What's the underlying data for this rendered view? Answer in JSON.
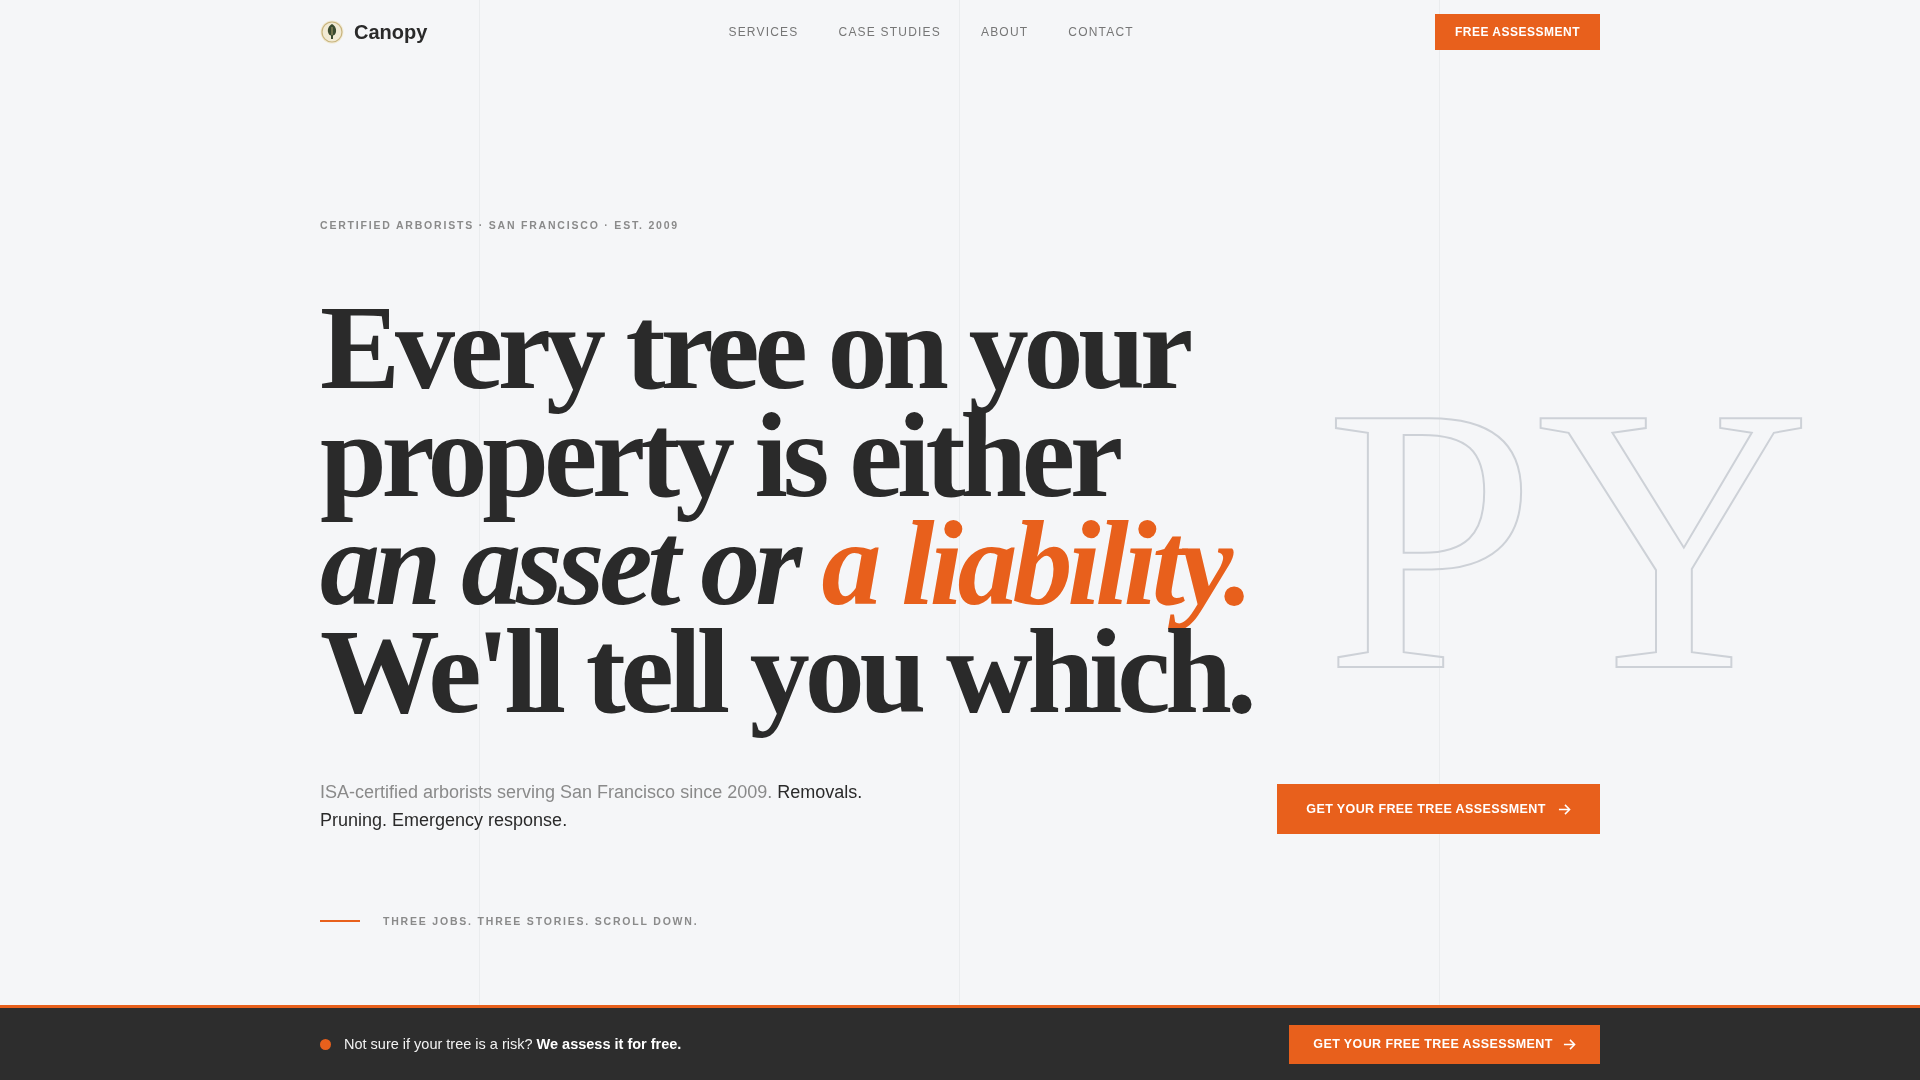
{
  "header": {
    "brand": "Canopy",
    "nav": [
      "SERVICES",
      "CASE STUDIES",
      "ABOUT",
      "CONTACT"
    ],
    "cta": "FREE ASSESSMENT"
  },
  "hero": {
    "backdrop_letters": "PY",
    "eyebrow": "CERTIFIED ARBORISTS · SAN FRANCISCO · EST. 2009",
    "headline": [
      [
        {
          "text": "Every tree on your",
          "kind": "plain"
        }
      ],
      [
        {
          "text": "property is either",
          "kind": "plain"
        }
      ],
      [
        {
          "text": "an asset or",
          "kind": "italic"
        },
        {
          "text": "a liability.",
          "kind": "accent"
        }
      ],
      [
        {
          "text": "We'll tell you which.",
          "kind": "plain"
        }
      ]
    ],
    "description": [
      {
        "text": "ISA-certified arborists serving San Francisco since 2009.",
        "kind": "muted"
      },
      {
        "text": "Removals. Pruning. Emergency response.",
        "kind": "strong"
      }
    ],
    "cta": "GET YOUR FREE TREE ASSESSMENT",
    "scroll_hint": "THREE JOBS. THREE STORIES. SCROLL DOWN."
  },
  "bottom_bar": {
    "message": "Not sure if your tree is a risk? **We assess it for free.**",
    "cta": "GET YOUR FREE TREE ASSESSMENT"
  }
}
